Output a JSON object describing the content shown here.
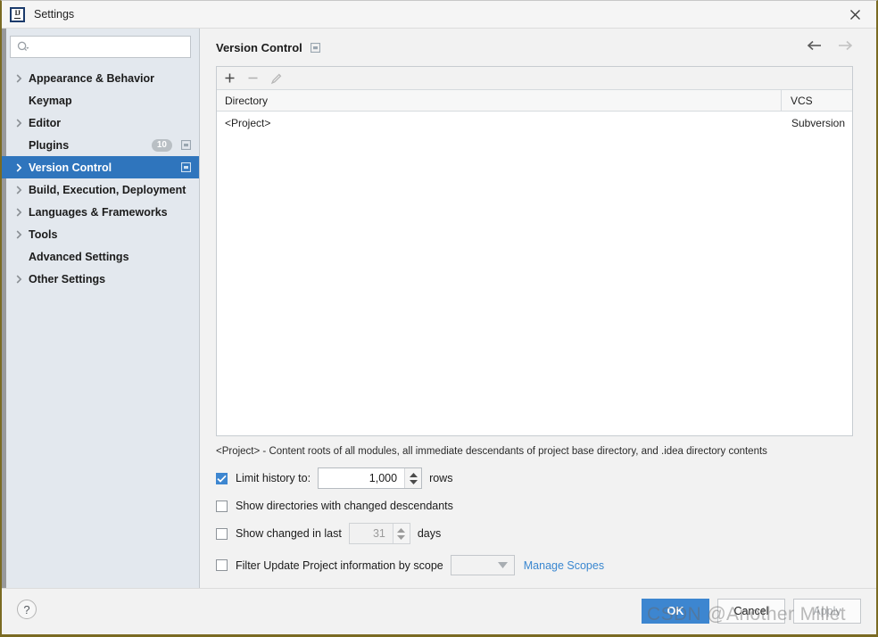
{
  "window": {
    "title": "Settings",
    "logo_text": "IJ",
    "close_icon": "close-icon"
  },
  "search": {
    "value": "",
    "placeholder": "",
    "icon": "search-icon"
  },
  "sidebar": {
    "items": [
      {
        "label": "Appearance & Behavior",
        "expandable": true,
        "selected": false,
        "badge": "",
        "panel_icon": false
      },
      {
        "label": "Keymap",
        "expandable": false,
        "selected": false,
        "badge": "",
        "panel_icon": false
      },
      {
        "label": "Editor",
        "expandable": true,
        "selected": false,
        "badge": "",
        "panel_icon": false
      },
      {
        "label": "Plugins",
        "expandable": false,
        "selected": false,
        "badge": "10",
        "panel_icon": true
      },
      {
        "label": "Version Control",
        "expandable": true,
        "selected": true,
        "badge": "",
        "panel_icon": true
      },
      {
        "label": "Build, Execution, Deployment",
        "expandable": true,
        "selected": false,
        "badge": "",
        "panel_icon": false
      },
      {
        "label": "Languages & Frameworks",
        "expandable": true,
        "selected": false,
        "badge": "",
        "panel_icon": false
      },
      {
        "label": "Tools",
        "expandable": true,
        "selected": false,
        "badge": "",
        "panel_icon": false
      },
      {
        "label": "Advanced Settings",
        "expandable": false,
        "selected": false,
        "badge": "",
        "panel_icon": false
      },
      {
        "label": "Other Settings",
        "expandable": true,
        "selected": false,
        "badge": "",
        "panel_icon": false
      }
    ]
  },
  "main": {
    "panel_title": "Version Control",
    "panel_title_icon": "panel-window-icon",
    "nav_back_icon": "arrow-left-icon",
    "nav_forward_icon": "arrow-right-icon",
    "toolbar": {
      "add_icon": "plus-icon",
      "remove_icon": "minus-icon",
      "edit_icon": "pencil-icon"
    },
    "table": {
      "columns": [
        "Directory",
        "VCS"
      ],
      "rows": [
        {
          "directory": "<Project>",
          "vcs": "Subversion"
        }
      ]
    },
    "hint": "<Project> - Content roots of all modules, all immediate descendants of project base directory, and .idea directory contents",
    "options": {
      "limit_history": {
        "label": "Limit history to:",
        "checked": true,
        "value": "1,000",
        "suffix": "rows"
      },
      "show_directories": {
        "label": "Show directories with changed descendants",
        "checked": false
      },
      "show_changed_in_last": {
        "label": "Show changed in last",
        "checked": false,
        "value": "31",
        "suffix": "days"
      },
      "filter_by_scope": {
        "label": "Filter Update Project information by scope",
        "checked": false,
        "scope_value": "",
        "manage_link": "Manage Scopes"
      }
    }
  },
  "footer": {
    "help_label": "?",
    "ok_label": "OK",
    "cancel_label": "Cancel",
    "apply_label": "Apply"
  },
  "watermark": {
    "text": "CSDN @Another Millet"
  },
  "colors": {
    "accent": "#3d86d0",
    "selection": "#2f75bd",
    "sidebar_bg": "#e3e8ee",
    "link": "#3a87d0",
    "window_border": "#7a6a22"
  }
}
